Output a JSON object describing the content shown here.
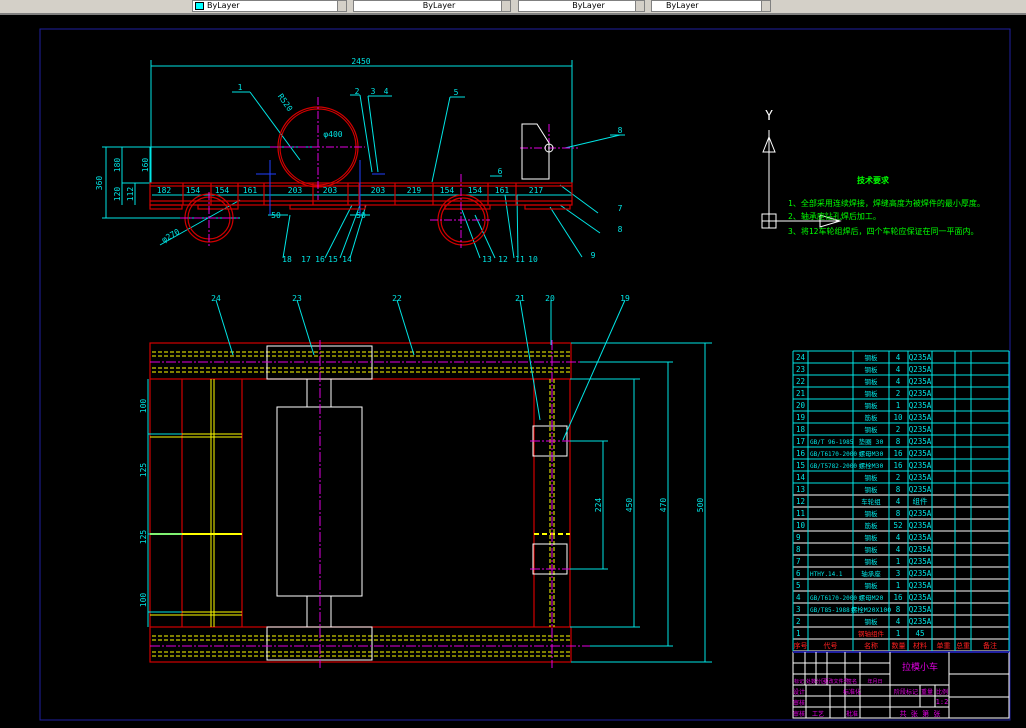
{
  "toolbar": {
    "layer_controls": [
      "ByLayer",
      "ByLayer",
      "ByLayer",
      "ByLayer"
    ],
    "color_swatch": "#00ffff"
  },
  "colors": {
    "frame": "#d00000",
    "dim": "#00e5e5",
    "center": "#e000e0",
    "hidden": "#ffff00",
    "border": "#2020a0",
    "text_green": "#00ff00",
    "title_magenta": "#e000e0",
    "header_red": "#ff2020"
  },
  "front_view": {
    "overall_length": "2450",
    "segments": [
      "182",
      "154",
      "154",
      "161",
      "203",
      "203",
      "203",
      "219",
      "154",
      "154",
      "161",
      "217"
    ],
    "height_dims": [
      "360",
      "180",
      "160",
      "120",
      "112"
    ],
    "diameters": [
      "R520",
      "φ400",
      "φ270"
    ],
    "small_dims": [
      "50",
      "50",
      "6"
    ],
    "balloons_top": [
      "1",
      "2",
      "3",
      "4",
      "5"
    ],
    "balloons_right": [
      "8",
      "7",
      "8",
      "9"
    ],
    "balloons_bottom": [
      "18",
      "17",
      "16",
      "15",
      "14",
      "13",
      "12",
      "11",
      "10"
    ]
  },
  "plan_view": {
    "balloons": [
      "24",
      "23",
      "22",
      "21",
      "20",
      "19"
    ],
    "left_dims": [
      "100",
      "125",
      "125",
      "100"
    ],
    "right_dims": [
      "224",
      "450",
      "470",
      "500"
    ]
  },
  "axis_icon": {
    "label": "Y"
  },
  "tech_requirements": {
    "title": "技术要求",
    "items": [
      "1、全部采用连续焊接，焊缝高度为被焊件的最小厚度。",
      "2、轴承座钻孔焊后加工。",
      "3、将12车轮组焊后，四个车轮应保证在同一平面内。"
    ]
  },
  "parts_list": {
    "headers": [
      "序号",
      "代号",
      "名称",
      "数量",
      "材料",
      "单重",
      "总重",
      "备注"
    ],
    "rows": [
      {
        "no": "24",
        "code": "",
        "name": "钢板",
        "qty": "4",
        "mat": "Q235A"
      },
      {
        "no": "23",
        "code": "",
        "name": "钢板",
        "qty": "4",
        "mat": "Q235A"
      },
      {
        "no": "22",
        "code": "",
        "name": "钢板",
        "qty": "4",
        "mat": "Q235A"
      },
      {
        "no": "21",
        "code": "",
        "name": "钢板",
        "qty": "2",
        "mat": "Q235A"
      },
      {
        "no": "20",
        "code": "",
        "name": "钢板",
        "qty": "1",
        "mat": "Q235A"
      },
      {
        "no": "19",
        "code": "",
        "name": "筋板",
        "qty": "10",
        "mat": "Q235A"
      },
      {
        "no": "18",
        "code": "",
        "name": "钢板",
        "qty": "2",
        "mat": "Q235A"
      },
      {
        "no": "17",
        "code": "GB/T 96-1985",
        "name": "垫圈 30",
        "qty": "8",
        "mat": "Q235A"
      },
      {
        "no": "16",
        "code": "GB/T6170-2000",
        "name": "螺母M30",
        "qty": "16",
        "mat": "Q235A"
      },
      {
        "no": "15",
        "code": "GB/T5782-2000",
        "name": "螺栓M30",
        "qty": "16",
        "mat": "Q235A"
      },
      {
        "no": "14",
        "code": "",
        "name": "钢板",
        "qty": "2",
        "mat": "Q235A"
      },
      {
        "no": "13",
        "code": "",
        "name": "钢板",
        "qty": "8",
        "mat": "Q235A"
      },
      {
        "no": "12",
        "code": "",
        "name": "车轮组",
        "qty": "4",
        "mat": "组件"
      },
      {
        "no": "11",
        "code": "",
        "name": "钢板",
        "qty": "8",
        "mat": "Q235A"
      },
      {
        "no": "10",
        "code": "",
        "name": "筋板",
        "qty": "52",
        "mat": "Q235A"
      },
      {
        "no": "9",
        "code": "",
        "name": "钢板",
        "qty": "4",
        "mat": "Q235A"
      },
      {
        "no": "8",
        "code": "",
        "name": "钢板",
        "qty": "4",
        "mat": "Q235A"
      },
      {
        "no": "7",
        "code": "",
        "name": "钢板",
        "qty": "1",
        "mat": "Q235A"
      },
      {
        "no": "6",
        "code": "HTHY.14.1",
        "name": "轴承座",
        "qty": "3",
        "mat": "Q235A"
      },
      {
        "no": "5",
        "code": "",
        "name": "钢板",
        "qty": "1",
        "mat": "Q235A"
      },
      {
        "no": "4",
        "code": "GB/T6170-2000",
        "name": "螺母M20",
        "qty": "16",
        "mat": "Q235A"
      },
      {
        "no": "3",
        "code": "GB/T85-1988",
        "name": "螺栓M20X100",
        "qty": "8",
        "mat": "Q235A"
      },
      {
        "no": "2",
        "code": "",
        "name": "钢板",
        "qty": "4",
        "mat": "Q235A"
      },
      {
        "no": "1",
        "code": "",
        "name": "钢轴组件",
        "qty": "1",
        "mat": "45"
      }
    ]
  },
  "title_block": {
    "drawing_title": "拉模小车",
    "left_labels": [
      "标记",
      "处数",
      "分区",
      "更改文件号",
      "签名",
      "年月日"
    ],
    "row_labels": [
      "设计",
      "审核",
      "审核",
      "工艺"
    ],
    "mid_labels": [
      "标准化",
      "批准"
    ],
    "stage_labels": [
      "阶段标记",
      "重量",
      "比例"
    ],
    "scale": "1:2",
    "sheet": "共  张 第  张"
  }
}
